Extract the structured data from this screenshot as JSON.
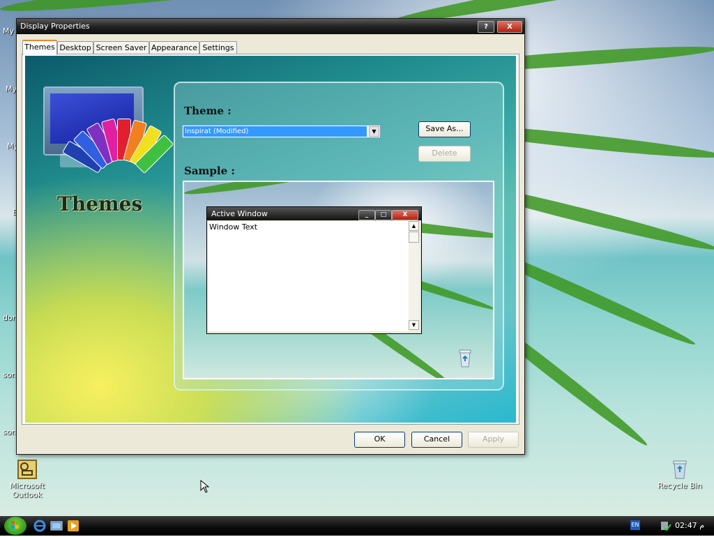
{
  "desktop": {
    "icons": [
      {
        "label": "Microsoft Outlook",
        "icon": "outlook-icon"
      },
      {
        "label": "Recycle Bin",
        "icon": "recycle-bin-icon"
      }
    ],
    "edge_labels": [
      "My",
      "My",
      "My",
      "E",
      "don",
      "son",
      "son"
    ]
  },
  "window": {
    "title": "Display Properties",
    "help_label": "?",
    "close_label": "X",
    "tabs": [
      {
        "label": "Themes",
        "active": true
      },
      {
        "label": "Desktop",
        "active": false
      },
      {
        "label": "Screen Saver",
        "active": false
      },
      {
        "label": "Appearance",
        "active": false
      },
      {
        "label": "Settings",
        "active": false
      }
    ],
    "themes_logo_text": "Themes",
    "theme_label": "Theme :",
    "theme_value": "Inspirat (Modified)",
    "save_as_label": "Save As...",
    "delete_label": "Delete",
    "sample_label": "Sample :",
    "sample_window": {
      "title": "Active Window",
      "body_text": "Window Text"
    },
    "buttons": {
      "ok": "OK",
      "cancel": "Cancel",
      "apply": "Apply"
    }
  },
  "taskbar": {
    "language": "EN",
    "clock": "02:47 م",
    "quick_launch": [
      "internet-explorer-icon",
      "show-desktop-icon",
      "media-player-icon"
    ]
  },
  "colors": {
    "title_bar": "#111111",
    "tab_highlight": "#e68b2c",
    "selection": "#3399ff",
    "close_button": "#c03a28"
  }
}
